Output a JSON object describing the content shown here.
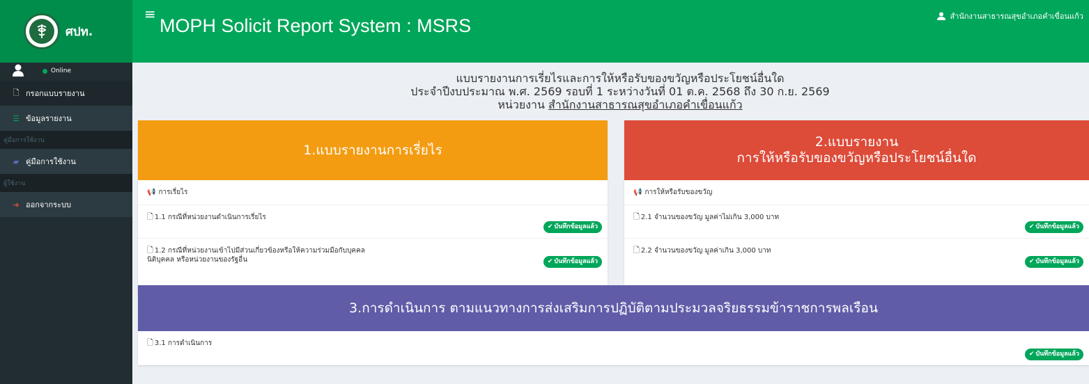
{
  "header": {
    "logo_text": "ศปท.",
    "title": "MOPH Solicit Report System : MSRS",
    "user": "สำนักงานสาธารณสุขอำเภอคำเขื่อนแก้ว"
  },
  "sidebar": {
    "status": "Online",
    "items": [
      {
        "label": "กรอกแบบรายงาน"
      },
      {
        "label": "ข้อมูลรายงาน"
      }
    ],
    "header_manual": "คู่มือการใช้งาน",
    "manual_item": "คู่มือการใช้งาน",
    "header_user": "ผู้ใช้งาน",
    "logout": "ออกจากระบบ"
  },
  "page": {
    "title_line1": "แบบรายงานการเรี่ยไรและการให้หรือรับของขวัญหรือประโยชน์อื่นใด",
    "title_line2": "ประจำปีงบประมาณ พ.ศ. 2569 รอบที่ 1 ระหว่างวันที่ 01 ต.ค. 2568 ถึง 30 ก.ย. 2569",
    "unit_label": "หน่วยงาน",
    "unit_name": "สำนักงานสาธารณสุขอำเภอคำเขื่อนแก้ว"
  },
  "cards": {
    "c1": {
      "num": "1.",
      "title": "แบบรายงานการเรี่ยไร",
      "sub": "การเรี่ยไร",
      "rows": [
        {
          "text": "1.1 กรณีที่หน่วยงานดำเนินการเรี่ยไร",
          "badge": "บันทึกข้อมูลแล้ว"
        },
        {
          "text": "1.2 กรณีที่หน่วยงานเข้าไปมีส่วนเกี่ยวข้องหรือให้ความร่วมมือกับบุคคล",
          "text2": "นิติบุคคล หรือหน่วยงานของรัฐอื่น",
          "badge": "บันทึกข้อมูลแล้ว"
        }
      ],
      "color": "#f39c12"
    },
    "c2": {
      "num": "2.",
      "title_line1": "แบบรายงาน",
      "title_line2": "การให้หรือรับของขวัญหรือประโยชน์อื่นใด",
      "sub": "การให้หรือรับของขวัญ",
      "rows": [
        {
          "text": "2.1 จำนวนของขวัญ มูลค่าไม่เกิน 3,000 บาท",
          "badge": "บันทึกข้อมูลแล้ว"
        },
        {
          "text": "2.2 จำนวนของขวัญ มูลค่าเกิน 3,000 บาท",
          "badge": "บันทึกข้อมูลแล้ว"
        }
      ],
      "color": "#dd4b39"
    },
    "c3": {
      "num": "3.",
      "title": "การดำเนินการ ตามแนวทางการส่งเสริมการปฏิบัติตามประมวลจริยธรรมข้าราชการพลเรือน",
      "rows": [
        {
          "text": "3.1 การดำเนินการ",
          "badge": "บันทึกข้อมูลแล้ว"
        }
      ],
      "color": "#605ca8"
    }
  }
}
